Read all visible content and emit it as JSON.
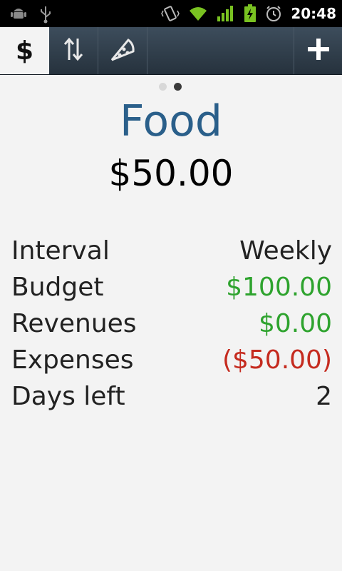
{
  "status_bar": {
    "time": "20:48",
    "icons": [
      "android-debug-icon",
      "usb-icon",
      "vibrate-icon",
      "wifi-icon",
      "signal-icon",
      "battery-charging-icon",
      "alarm-icon"
    ]
  },
  "tabs": [
    {
      "name": "tab-budget",
      "icon": "dollar-icon",
      "label": "$",
      "active": true
    },
    {
      "name": "tab-transactions",
      "icon": "transfer-arrows-icon",
      "active": false
    },
    {
      "name": "tab-categories",
      "icon": "pizza-slice-icon",
      "active": false
    }
  ],
  "add_button": {
    "icon": "plus-icon"
  },
  "pager": {
    "count": 2,
    "active_index": 1
  },
  "budget": {
    "title": "Food",
    "amount": "$50.00"
  },
  "details": [
    {
      "label": "Interval",
      "value": "Weekly",
      "color": "#222222"
    },
    {
      "label": "Budget",
      "value": "$100.00",
      "color": "#2ea32e"
    },
    {
      "label": "Revenues",
      "value": "$0.00",
      "color": "#2ea32e"
    },
    {
      "label": "Expenses",
      "value": "($50.00)",
      "color": "#c52b1f"
    },
    {
      "label": "Days left",
      "value": "2",
      "color": "#222222"
    }
  ],
  "colors": {
    "accent_title": "#2a5f8a",
    "positive": "#2ea32e",
    "negative": "#c52b1f",
    "action_bar": "#2e3b48"
  }
}
